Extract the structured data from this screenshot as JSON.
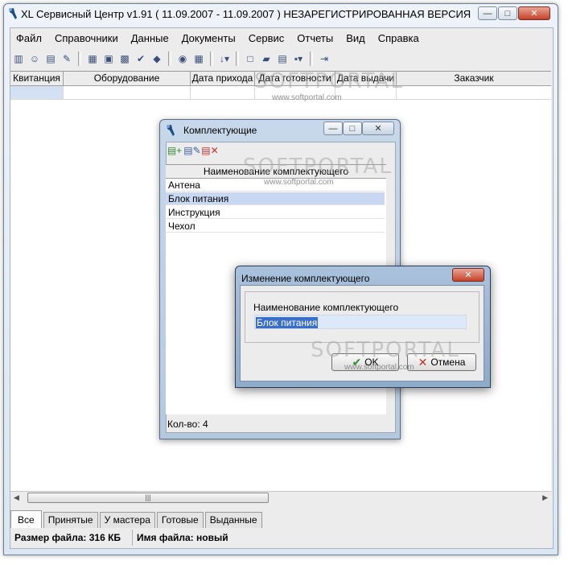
{
  "main_window": {
    "title": "XL Сервисный Центр v1.91   ( 11.09.2007 - 11.09.2007 ) НЕЗАРЕГИСТРИРОВАННАЯ ВЕРСИЯ",
    "controls": {
      "minimize": "—",
      "maximize": "□",
      "close": "✕"
    }
  },
  "menu": [
    "Файл",
    "Справочники",
    "Данные",
    "Документы",
    "Сервис",
    "Отчеты",
    "Вид",
    "Справка"
  ],
  "main_grid": {
    "columns": [
      "Квитанция",
      "Оборудование",
      "Дата прихода",
      "Дата готовности",
      "Дата выдачи",
      "Заказчик"
    ]
  },
  "tabs": [
    "Все",
    "Принятые",
    "У мастера",
    "Готовые",
    "Выданные"
  ],
  "status": {
    "file_size": "Размер файла: 316 КБ",
    "file_name": "Имя файла: новый"
  },
  "watermark": {
    "logo": "SOFTPORTAL",
    "url": "www.softportal.com"
  },
  "parts_window": {
    "title": "Комплектующие",
    "column": "Наименование комплектующего",
    "rows": [
      "Антена",
      "Блок питания",
      "Инструкция",
      "Чехол"
    ],
    "selected_index": 1,
    "count": "Кол-во: 4"
  },
  "edit_dialog": {
    "title": "Изменение комплектующего",
    "field_label": "Наименование комплектующего",
    "field_value": "Блок питания",
    "ok_label": "OK",
    "cancel_label": "Отмена"
  },
  "colors": {
    "selection": "#3a6fc8",
    "row_highlight": "#c8d8f2",
    "close_button": "#c4422a"
  }
}
